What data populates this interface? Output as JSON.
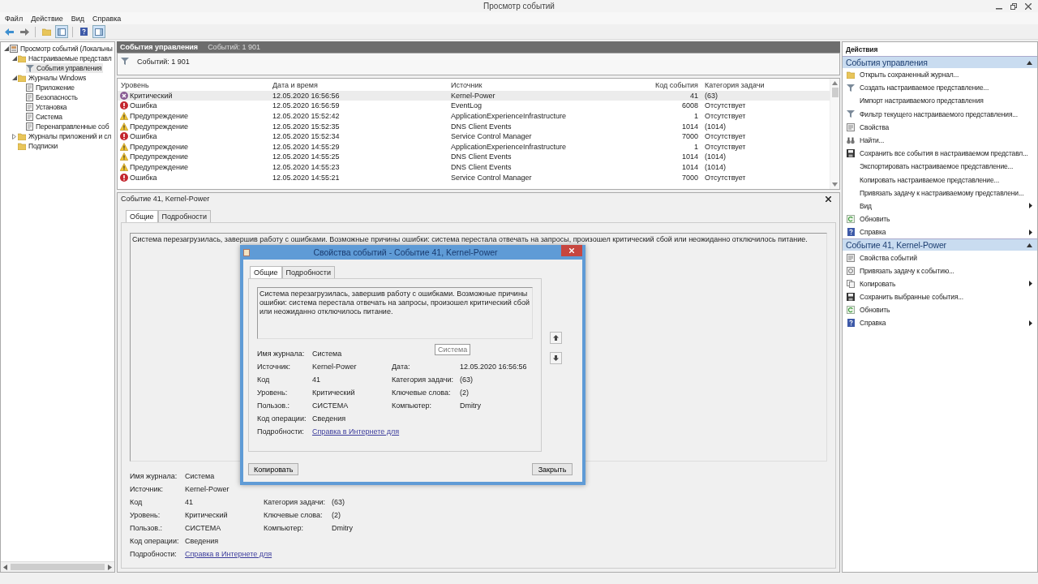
{
  "window": {
    "title": "Просмотр событий"
  },
  "menu": [
    "Файл",
    "Действие",
    "Вид",
    "Справка"
  ],
  "tree": [
    {
      "label": "Просмотр событий (Локальны",
      "kind": "viewer",
      "selected": false,
      "expanded": true,
      "children": [
        {
          "label": "Настраиваемые представл",
          "kind": "folder",
          "selected": false,
          "expanded": true,
          "children": [
            {
              "label": "События управления",
              "kind": "filter",
              "selected": true
            }
          ]
        },
        {
          "label": "Журналы Windows",
          "kind": "folder",
          "selected": false,
          "expanded": true,
          "children": [
            {
              "label": "Приложение",
              "kind": "log",
              "selected": false
            },
            {
              "label": "Безопасность",
              "kind": "log",
              "selected": false
            },
            {
              "label": "Установка",
              "kind": "log",
              "selected": false
            },
            {
              "label": "Система",
              "kind": "log",
              "selected": false
            },
            {
              "label": "Перенаправленные соб",
              "kind": "log",
              "selected": false
            }
          ]
        },
        {
          "label": "Журналы приложений и сл",
          "kind": "folder",
          "selected": false,
          "expanded": false
        },
        {
          "label": "Подписки",
          "kind": "folder",
          "selected": false
        }
      ]
    }
  ],
  "view": {
    "title": "События управления",
    "count": "Событий: 1 901",
    "filter_count": "Событий: 1 901"
  },
  "table": {
    "columns": [
      "Уровень",
      "Дата и время",
      "Источник",
      "Код события",
      "Категория задачи"
    ],
    "rows": [
      {
        "kind": "critical",
        "level": "Критический",
        "date": "12.05.2020 16:56:56",
        "source": "Kernel-Power",
        "code": "41",
        "category": "(63)",
        "selected": true
      },
      {
        "kind": "error",
        "level": "Ошибка",
        "date": "12.05.2020 16:56:59",
        "source": "EventLog",
        "code": "6008",
        "category": "Отсутствует",
        "selected": false
      },
      {
        "kind": "warning",
        "level": "Предупреждение",
        "date": "12.05.2020 15:52:42",
        "source": "ApplicationExperienceInfrastructure",
        "code": "1",
        "category": "Отсутствует",
        "selected": false
      },
      {
        "kind": "warning",
        "level": "Предупреждение",
        "date": "12.05.2020 15:52:35",
        "source": "DNS Client Events",
        "code": "1014",
        "category": "(1014)",
        "selected": false
      },
      {
        "kind": "error",
        "level": "Ошибка",
        "date": "12.05.2020 15:52:34",
        "source": "Service Control Manager",
        "code": "7000",
        "category": "Отсутствует",
        "selected": false
      },
      {
        "kind": "warning",
        "level": "Предупреждение",
        "date": "12.05.2020 14:55:29",
        "source": "ApplicationExperienceInfrastructure",
        "code": "1",
        "category": "Отсутствует",
        "selected": false
      },
      {
        "kind": "warning",
        "level": "Предупреждение",
        "date": "12.05.2020 14:55:25",
        "source": "DNS Client Events",
        "code": "1014",
        "category": "(1014)",
        "selected": false
      },
      {
        "kind": "warning",
        "level": "Предупреждение",
        "date": "12.05.2020 14:55:23",
        "source": "DNS Client Events",
        "code": "1014",
        "category": "(1014)",
        "selected": false
      },
      {
        "kind": "error",
        "level": "Ошибка",
        "date": "12.05.2020 14:55:21",
        "source": "Service Control Manager",
        "code": "7000",
        "category": "Отсутствует",
        "selected": false
      }
    ]
  },
  "details": {
    "title": "Событие 41, Kernel-Power",
    "tabs": [
      {
        "label": "Общие",
        "selected": true
      },
      {
        "label": "Подробности",
        "selected": false
      }
    ],
    "description": "Система перезагрузилась, завершив работу с ошибками. Возможные причины ошибки: система перестала отвечать на запросы, произошел критический сбой или неожиданно отключилось питание.",
    "fields_left": [
      {
        "label": "Имя журнала:",
        "value": "Система"
      },
      {
        "label": "Источник:",
        "value": "Kernel-Power"
      },
      {
        "label": "Код",
        "value": "41"
      },
      {
        "label": "Уровень:",
        "value": "Критический"
      },
      {
        "label": "Пользов.:",
        "value": "СИСТЕМА"
      },
      {
        "label": "Код операции:",
        "value": "Сведения"
      },
      {
        "label": "Подробности:",
        "value": "Справка в Интернете для",
        "kind": "link"
      }
    ],
    "fields_right": [
      {
        "label": "Категория задачи:",
        "value": "(63)"
      },
      {
        "label": "Ключевые слова:",
        "value": "(2)"
      },
      {
        "label": "Компьютер:",
        "value": "Dmitry"
      }
    ]
  },
  "dialog": {
    "title": "Свойства событий - Событие 41, Kernel-Power",
    "tabs": [
      {
        "label": "Общие",
        "selected": true
      },
      {
        "label": "Подробности",
        "selected": false
      }
    ],
    "description": "Система перезагрузилась, завершив работу с ошибками. Возможные причины ошибки: система перестала отвечать на запросы, произошел критический сбой или неожиданно отключилось питание.",
    "fields_left": [
      {
        "label": "Имя журнала:",
        "value": "Система"
      },
      {
        "label": "Источник:",
        "value": "Kernel-Power"
      },
      {
        "label": "Код",
        "value": "41"
      },
      {
        "label": "Уровень:",
        "value": "Критический"
      },
      {
        "label": "Пользов.:",
        "value": "СИСТЕМА"
      },
      {
        "label": "Код операции:",
        "value": "Сведения"
      },
      {
        "label": "Подробности:",
        "value": "Справка в Интернете для",
        "kind": "link"
      }
    ],
    "fields_right": [
      {
        "label": "Дата:",
        "value": "12.05.2020 16:56:56"
      },
      {
        "label": "Категория задачи:",
        "value": "(63)"
      },
      {
        "label": "Ключевые слова:",
        "value": "(2)"
      },
      {
        "label": "Компьютер:",
        "value": "Dmitry"
      }
    ],
    "tooltip": "Система",
    "buttons": [
      "Копировать",
      "Закрыть"
    ]
  },
  "actions": {
    "title": "Действия",
    "sections": [
      {
        "title": "События управления",
        "expanded": true,
        "items": [
          {
            "label": "Открыть сохраненный журнал...",
            "kind": "folder"
          },
          {
            "label": "Создать настраиваемое представление...",
            "kind": "filter"
          },
          {
            "label": "Импорт настраиваемого представления"
          },
          {
            "label": "Фильтр текущего настраиваемого представления...",
            "kind": "filter"
          },
          {
            "label": "Свойства",
            "kind": "properties"
          },
          {
            "label": "Найти...",
            "kind": "find"
          },
          {
            "label": "Сохранить все события в настраиваемом представл...",
            "kind": "save"
          },
          {
            "label": "Экспортировать настраиваемое представление..."
          },
          {
            "label": "Копировать настраиваемое представление..."
          },
          {
            "label": "Привязать задачу к настраиваемому представлени..."
          },
          {
            "label": "Вид",
            "submenu": true
          },
          {
            "label": "Обновить",
            "kind": "refresh"
          },
          {
            "label": "Справка",
            "kind": "help",
            "submenu": true
          }
        ]
      },
      {
        "title": "Событие 41, Kernel-Power",
        "expanded": true,
        "items": [
          {
            "label": "Свойства событий",
            "kind": "properties"
          },
          {
            "label": "Привязать задачу к событию...",
            "kind": "task"
          },
          {
            "label": "Копировать",
            "kind": "copy",
            "submenu": true
          },
          {
            "label": "Сохранить выбранные события...",
            "kind": "save"
          },
          {
            "label": "Обновить",
            "kind": "refresh"
          },
          {
            "label": "Справка",
            "kind": "help",
            "submenu": true
          }
        ]
      }
    ]
  }
}
